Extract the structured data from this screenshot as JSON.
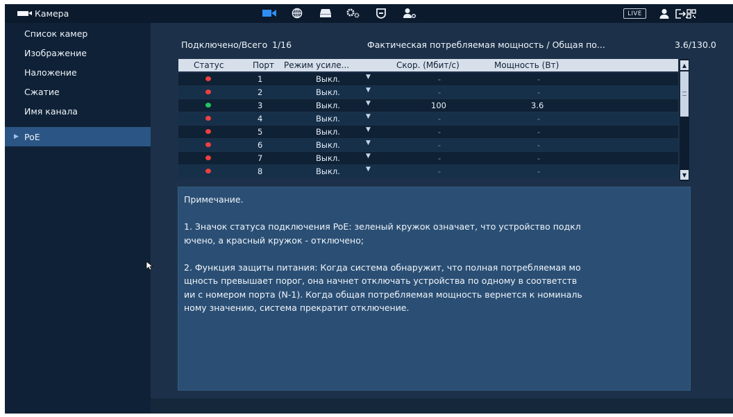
{
  "header": {
    "title": "Камера",
    "icons": [
      "camera-icon",
      "network-icon",
      "storage-icon",
      "settings-icon",
      "security-icon",
      "account-icon"
    ],
    "live_label": "LIVE",
    "right_icons": [
      "user-icon",
      "logout-icon",
      "qr-code-icon"
    ]
  },
  "sidebar": {
    "items": [
      {
        "label": "Список камер",
        "active": false
      },
      {
        "label": "Изображение",
        "active": false
      },
      {
        "label": "Наложение",
        "active": false
      },
      {
        "label": "Сжатие",
        "active": false
      },
      {
        "label": "Имя канала",
        "active": false
      },
      {
        "label": "PoE",
        "active": true
      }
    ]
  },
  "summary": {
    "connected_label": "Подключено/Всего",
    "connected_value": "1/16",
    "power_label": "Фактическая потребляемая мощность / Общая по...",
    "power_value": "3.6/130.0"
  },
  "table": {
    "columns": [
      "Статус",
      "Порт",
      "Режим усиле...",
      "Скор. (Мбит/с)",
      "Мощность (Вт)"
    ],
    "rows": [
      {
        "status": "off",
        "port": "1",
        "mode": "Выкл.",
        "speed": "-",
        "power": "-"
      },
      {
        "status": "off",
        "port": "2",
        "mode": "Выкл.",
        "speed": "-",
        "power": "-"
      },
      {
        "status": "on",
        "port": "3",
        "mode": "Выкл.",
        "speed": "100",
        "power": "3.6"
      },
      {
        "status": "off",
        "port": "4",
        "mode": "Выкл.",
        "speed": "-",
        "power": "-"
      },
      {
        "status": "off",
        "port": "5",
        "mode": "Выкл.",
        "speed": "-",
        "power": "-"
      },
      {
        "status": "off",
        "port": "6",
        "mode": "Выкл.",
        "speed": "-",
        "power": "-"
      },
      {
        "status": "off",
        "port": "7",
        "mode": "Выкл.",
        "speed": "-",
        "power": "-"
      },
      {
        "status": "off",
        "port": "8",
        "mode": "Выкл.",
        "speed": "-",
        "power": "-"
      }
    ]
  },
  "colors": {
    "status_on": "#22c55e",
    "status_off": "#ef3f3f",
    "accent": "#2a5584"
  },
  "note": {
    "title": "Примечание.",
    "item1": "1. Значок статуса подключения PoE: зеленый кружок означает, что устройство подкл\nючено, а красный кружок - отключено;",
    "item2": "2. Функция защиты питания: Когда система обнаружит, что полная потребляемая мо\nщность превышает порог, она начнет отключать устройства по одному в соответств\nии с номером порта (N-1). Когда общая потребляемая мощность вернется к номиналь\nному значению, система прекратит отключение."
  }
}
